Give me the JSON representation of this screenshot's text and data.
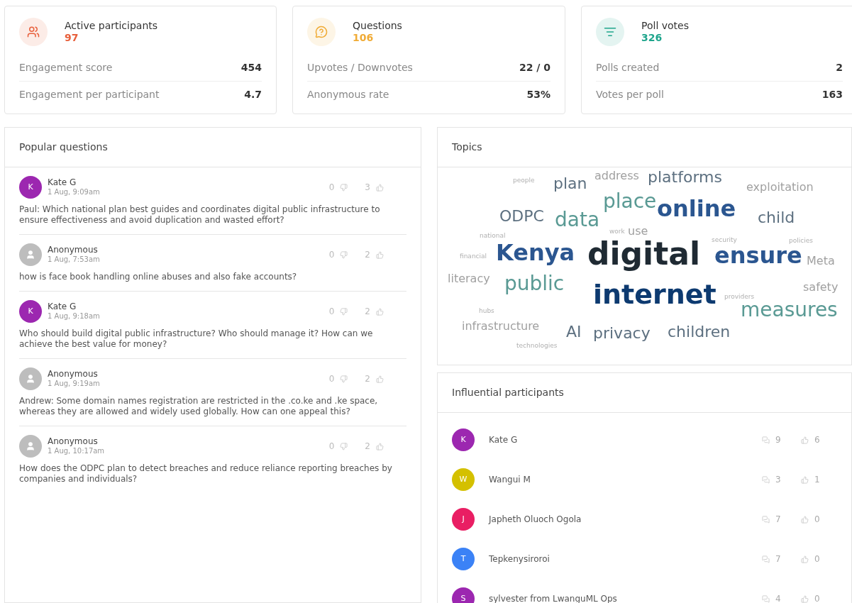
{
  "stats": [
    {
      "title": "Active participants",
      "value": "97",
      "color": "#e8603c",
      "kind": "people",
      "rows": [
        {
          "label": "Engagement score",
          "value": "454"
        },
        {
          "label": "Engagement per participant",
          "value": "4.7"
        }
      ]
    },
    {
      "title": "Questions",
      "value": "106",
      "color": "#f0ab35",
      "kind": "question",
      "rows": [
        {
          "label": "Upvotes / Downvotes",
          "value": "22 / 0"
        },
        {
          "label": "Anonymous rate",
          "value": "53%"
        }
      ]
    },
    {
      "title": "Poll votes",
      "value": "326",
      "color": "#1fa58c",
      "kind": "poll",
      "rows": [
        {
          "label": "Polls created",
          "value": "2"
        },
        {
          "label": "Votes per poll",
          "value": "163"
        }
      ]
    }
  ],
  "popular_questions": {
    "title": "Popular questions",
    "items": [
      {
        "author": "Kate G",
        "initial": "K",
        "anonymous": false,
        "color": "#9c27b0",
        "time": "1 Aug, 9:09am",
        "downvotes": "0",
        "upvotes": "3",
        "text": "Paul: Which national plan best guides and coordinates digital public infrastructure to ensure effectiveness and avoid duplication and wasted effort?"
      },
      {
        "author": "Anonymous",
        "anonymous": true,
        "color": "#bdbdbd",
        "time": "1 Aug, 7:53am",
        "downvotes": "0",
        "upvotes": "2",
        "text": "how is face book handling online abuses and also fake accounts?"
      },
      {
        "author": "Kate G",
        "initial": "K",
        "anonymous": false,
        "color": "#9c27b0",
        "time": "1 Aug, 9:18am",
        "downvotes": "0",
        "upvotes": "2",
        "text": "Who should build digital public infrastructure? Who should manage it? How can we achieve the best value for money?"
      },
      {
        "author": "Anonymous",
        "anonymous": true,
        "color": "#bdbdbd",
        "time": "1 Aug, 9:19am",
        "downvotes": "0",
        "upvotes": "2",
        "text": "Andrew: Some domain names registration are restricted in the .co.ke and .ke space, whereas they are allowed and widely used globally. How can one appeal this?"
      },
      {
        "author": "Anonymous",
        "anonymous": true,
        "color": "#bdbdbd",
        "time": "1 Aug, 10:17am",
        "downvotes": "0",
        "upvotes": "2",
        "text": "How does the ODPC plan to detect breaches and reduce reliance reporting breaches by companies and individuals?"
      }
    ]
  },
  "topics": {
    "title": "Topics",
    "words": [
      {
        "text": "people",
        "kind": "xs",
        "color": "#b0b0b0"
      },
      {
        "text": "plan",
        "kind": "md",
        "color": "#5d7080"
      },
      {
        "text": "address",
        "kind": "sm",
        "color": "#a0a0a0"
      },
      {
        "text": "platforms",
        "kind": "md",
        "color": "#5d7080"
      },
      {
        "text": "exploitation",
        "kind": "sm",
        "color": "#a0a0a0"
      },
      {
        "text": "ODPC",
        "kind": "md",
        "color": "#5d7080"
      },
      {
        "text": "data",
        "kind": "lg",
        "color": "#5a9a94"
      },
      {
        "text": "place",
        "kind": "lg",
        "color": "#5a9a94"
      },
      {
        "text": "online",
        "kind": "xl",
        "color": "#2b5690"
      },
      {
        "text": "child",
        "kind": "md",
        "color": "#5d7080"
      },
      {
        "text": "national",
        "kind": "xs",
        "color": "#b0b0b0"
      },
      {
        "text": "work",
        "kind": "xs",
        "color": "#b0b0b0"
      },
      {
        "text": "use",
        "kind": "sm",
        "color": "#a0a0a0"
      },
      {
        "text": "security",
        "kind": "xs",
        "color": "#b0b0b0"
      },
      {
        "text": "policies",
        "kind": "xs",
        "color": "#b0b0b0"
      },
      {
        "text": "financial",
        "kind": "xs",
        "color": "#b0b0b0"
      },
      {
        "text": "Kenya",
        "kind": "xl",
        "color": "#2b5690"
      },
      {
        "text": "digital",
        "kind": "huge",
        "color": "#1f2a33"
      },
      {
        "text": "ensure",
        "kind": "xl",
        "color": "#2b5690"
      },
      {
        "text": "Meta",
        "kind": "sm",
        "color": "#a0a0a0"
      },
      {
        "text": "literacy",
        "kind": "sm",
        "color": "#a0a0a0"
      },
      {
        "text": "public",
        "kind": "lg",
        "color": "#5a9a94"
      },
      {
        "text": "safety",
        "kind": "sm",
        "color": "#a0a0a0"
      },
      {
        "text": "providers",
        "kind": "xs",
        "color": "#b0b0b0"
      },
      {
        "text": "internet",
        "kind": "big",
        "color": "#0d3a70"
      },
      {
        "text": "hubs",
        "kind": "xs",
        "color": "#b0b0b0"
      },
      {
        "text": "measures",
        "kind": "lg",
        "color": "#5a9a94"
      },
      {
        "text": "infrastructure",
        "kind": "sm",
        "color": "#a0a0a0"
      },
      {
        "text": "AI",
        "kind": "md",
        "color": "#5d7080"
      },
      {
        "text": "privacy",
        "kind": "md",
        "color": "#5d7080"
      },
      {
        "text": "children",
        "kind": "md",
        "color": "#5d7080"
      },
      {
        "text": "technologies",
        "kind": "xs",
        "color": "#b0b0b0"
      }
    ]
  },
  "influential": {
    "title": "Influential participants",
    "items": [
      {
        "name": "Kate G",
        "initial": "K",
        "color": "#9c27b0",
        "questions": "9",
        "likes": "6"
      },
      {
        "name": "Wangui M",
        "initial": "W",
        "color": "#d4c000",
        "questions": "3",
        "likes": "1"
      },
      {
        "name": "Japheth Oluoch Ogola",
        "initial": "J",
        "color": "#e91e63",
        "questions": "7",
        "likes": "0"
      },
      {
        "name": "Tepkenysiroroi",
        "initial": "T",
        "color": "#3b82f6",
        "questions": "7",
        "likes": "0"
      },
      {
        "name": "sylvester from LwanguML Ops",
        "initial": "S",
        "color": "#9c27b0",
        "questions": "4",
        "likes": "0"
      }
    ]
  }
}
